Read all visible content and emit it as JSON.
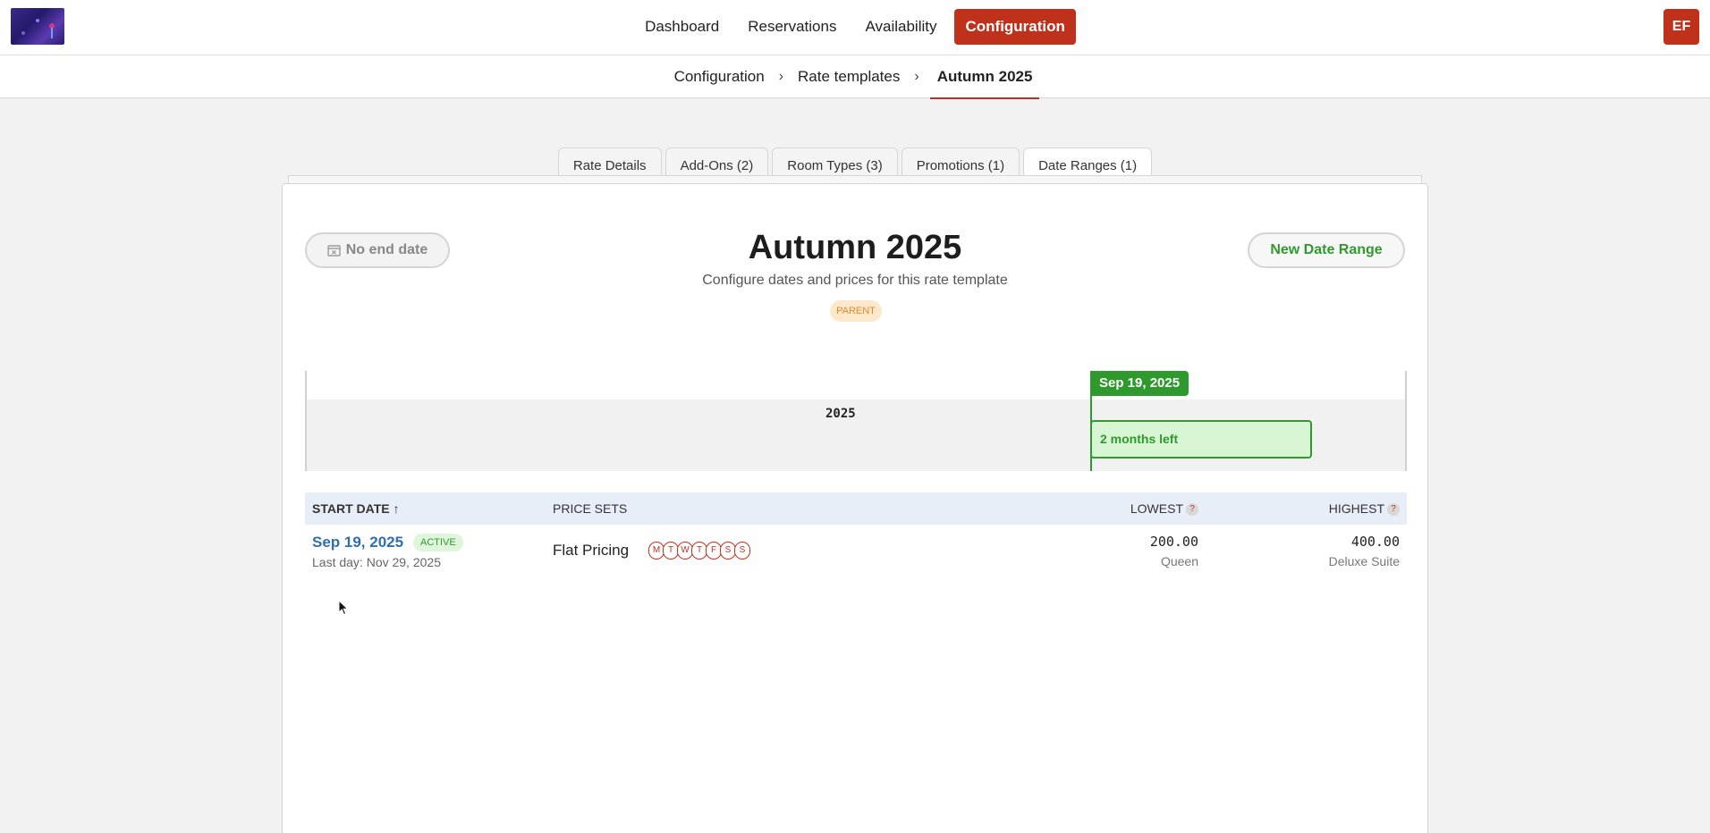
{
  "nav": {
    "items": [
      {
        "label": "Dashboard",
        "active": false
      },
      {
        "label": "Reservations",
        "active": false
      },
      {
        "label": "Availability",
        "active": false
      },
      {
        "label": "Configuration",
        "active": true
      }
    ],
    "avatar_initials": "EF"
  },
  "breadcrumb": {
    "items": [
      "Configuration",
      "Rate templates",
      "Autumn 2025"
    ],
    "separator": "›"
  },
  "tabs": [
    {
      "label": "Rate Details",
      "active": false
    },
    {
      "label": "Add-Ons (2)",
      "active": false
    },
    {
      "label": "Room Types (3)",
      "active": false
    },
    {
      "label": "Promotions (1)",
      "active": false
    },
    {
      "label": "Date Ranges (1)",
      "active": true
    }
  ],
  "header": {
    "no_end_date_label": "No end date",
    "new_range_label": "New Date Range",
    "title": "Autumn 2025",
    "subtitle": "Configure dates and prices for this rate template",
    "badge": "PARENT"
  },
  "timeline": {
    "year": "2025",
    "marker_date": "Sep 19, 2025",
    "range_label": "2 months left"
  },
  "table": {
    "headers": {
      "start_date": "START DATE ↑",
      "price_sets": "PRICE SETS",
      "lowest": "LOWEST",
      "highest": "HIGHEST",
      "help": "?"
    },
    "rows": [
      {
        "start_date": "Sep 19, 2025",
        "status": "ACTIVE",
        "last_day": "Last day: Nov 29, 2025",
        "price_set": "Flat Pricing",
        "days": [
          "M",
          "T",
          "W",
          "T",
          "F",
          "S",
          "S"
        ],
        "lowest": "200.00",
        "lowest_room": "Queen",
        "highest": "400.00",
        "highest_room": "Deluxe Suite"
      }
    ]
  },
  "colors": {
    "accent": "#c0311c",
    "success": "#2e9a2e",
    "link": "#2f6fb0"
  }
}
